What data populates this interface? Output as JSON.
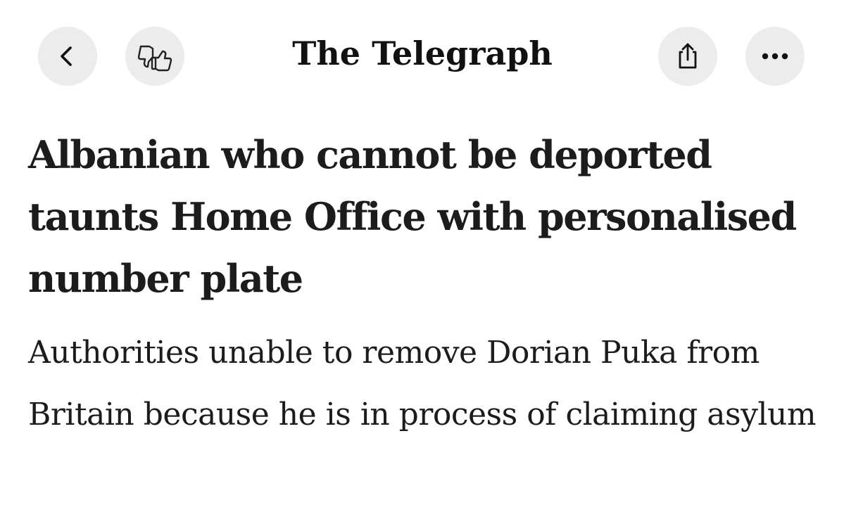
{
  "header": {
    "masthead": "The Telegraph",
    "back_icon": "chevron-left-icon",
    "feedback_icon": "thumbs-feedback-icon",
    "share_icon": "share-icon",
    "more_icon": "more-options-icon"
  },
  "article": {
    "headline": "Albanian who cannot be deported taunts Home Office with personalised number plate",
    "standfirst": "Authorities unable to remove Dorian Puka from Britain because he is in process of claiming asylum"
  },
  "colors": {
    "button_background": "#ececec",
    "text": "#1c1c1c",
    "background": "#ffffff"
  }
}
